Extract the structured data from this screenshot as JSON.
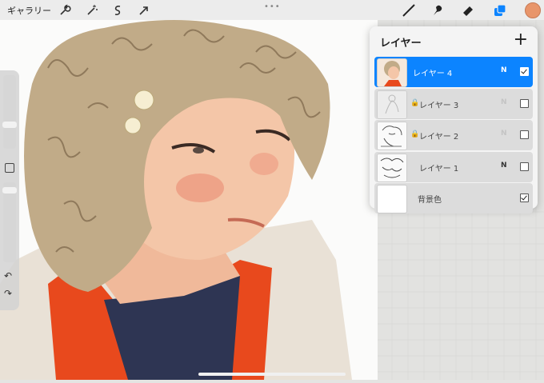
{
  "topbar": {
    "gallery_label": "ギャラリー",
    "tools_left": [
      "wrench-icon",
      "wand-icon",
      "selection-icon",
      "transform-arrow-icon"
    ],
    "tools_right": [
      "brush-icon",
      "smudge-icon",
      "eraser-icon",
      "layers-icon"
    ],
    "accent": "#0c84ff",
    "current_color": "#e8956a"
  },
  "sidebar": {
    "undo_icon": "undo-icon",
    "redo_icon": "redo-icon"
  },
  "layers_panel": {
    "title": "レイヤー",
    "add_icon": "plus-icon",
    "layers": [
      {
        "name": "レイヤー 4",
        "blend": "N",
        "visible": true,
        "selected": true,
        "locked": false
      },
      {
        "name": "レイヤー 3",
        "blend": "N",
        "visible": false,
        "selected": false,
        "locked": true
      },
      {
        "name": "レイヤー 2",
        "blend": "N",
        "visible": false,
        "selected": false,
        "locked": true
      },
      {
        "name": "レイヤー 1",
        "blend": "N",
        "visible": false,
        "selected": false,
        "locked": false
      },
      {
        "name": "背景色",
        "blend": "",
        "visible": true,
        "selected": false,
        "locked": false
      }
    ]
  }
}
